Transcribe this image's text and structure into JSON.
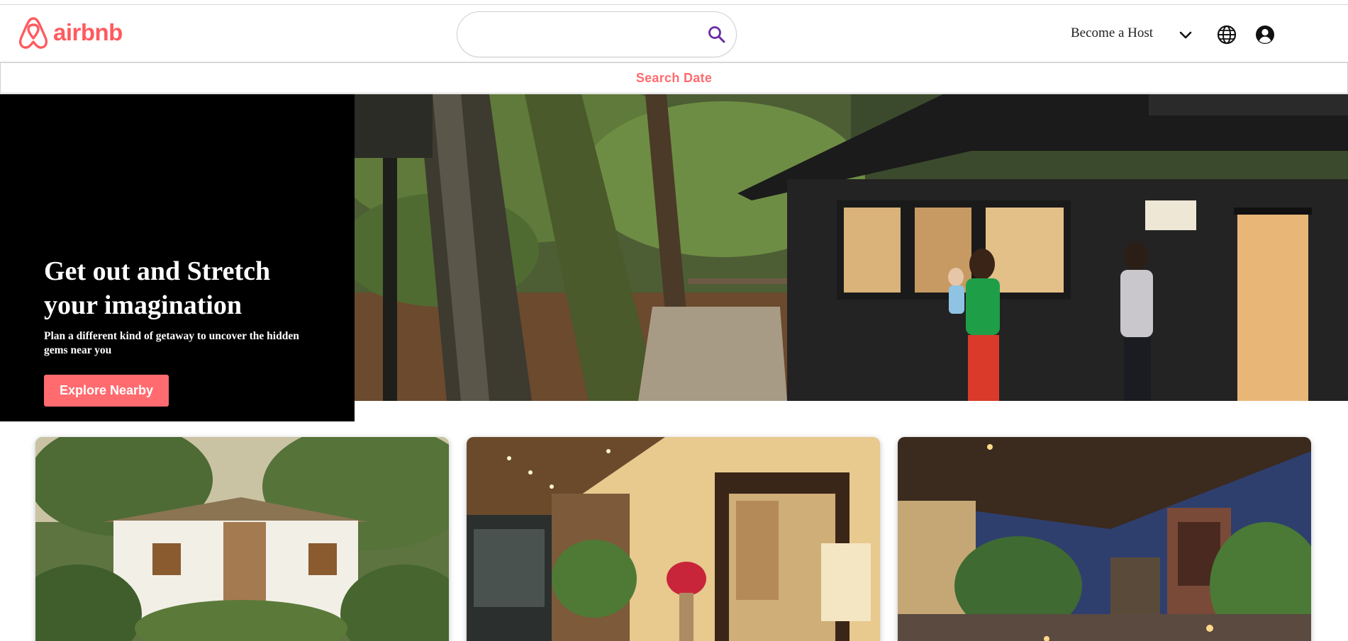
{
  "brand": {
    "name": "airbnb",
    "color": "#ff5a5f"
  },
  "header": {
    "search": {
      "value": "",
      "placeholder": "",
      "icon": "search-icon"
    },
    "host_link": "Become a Host",
    "icons": [
      "chevron-down-icon",
      "globe-icon",
      "account-circle-icon"
    ]
  },
  "date_bar": {
    "label": "Search Date"
  },
  "hero": {
    "title": "Get out and Stretch your imagination",
    "subtitle": "Plan a different kind of getaway to uncover the hidden gems near you",
    "button": "Explore Nearby",
    "image": "cabin-in-forest-family-photo"
  },
  "cards": [
    {
      "image": "white-cottage-with-palms"
    },
    {
      "image": "warm-lit-interior-hallway"
    },
    {
      "image": "courtyard-at-dusk"
    }
  ],
  "colors": {
    "accent": "#ff6b6f",
    "search_icon": "#6a2aa6",
    "hero_panel": "#000000"
  }
}
